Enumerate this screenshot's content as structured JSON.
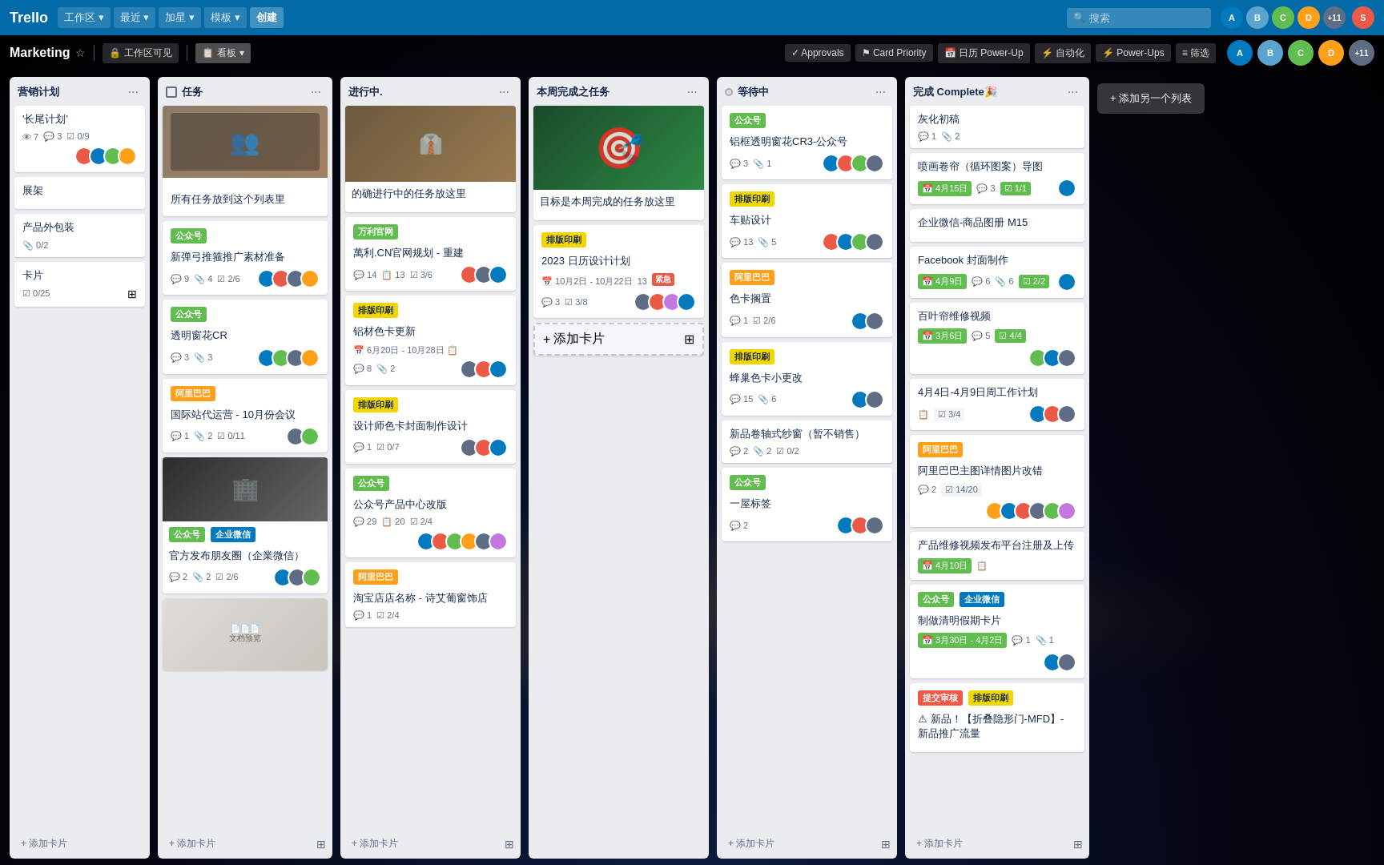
{
  "app": {
    "logo": "Trello",
    "nav": [
      {
        "label": "工作区",
        "hasArrow": true
      },
      {
        "label": "最近",
        "hasArrow": true
      },
      {
        "label": "加星",
        "hasArrow": true
      },
      {
        "label": "模板",
        "hasArrow": true
      },
      {
        "label": "创建",
        "isCreate": true
      }
    ],
    "search_placeholder": "搜索",
    "avatars": [
      "AB",
      "CD",
      "EF",
      "GH"
    ],
    "avatar_colors": [
      "#0079bf",
      "#5ba4cf",
      "#61bd4f",
      "#ff9f1a"
    ],
    "more_count": "+11"
  },
  "boardbar": {
    "title": "Marketing",
    "workspace_visibility": "工作区可见",
    "view_btn": "看板",
    "buttons": [
      {
        "label": "Approvals",
        "icon": "✓"
      },
      {
        "label": "Card Priority",
        "icon": "⚑"
      },
      {
        "label": "日历 Power-Up",
        "icon": "📅"
      },
      {
        "label": "自动化",
        "icon": "⚡"
      },
      {
        "label": "Power-Ups",
        "icon": "⚡"
      },
      {
        "label": "筛选",
        "icon": "≡"
      }
    ]
  },
  "columns": [
    {
      "id": "col1",
      "title": "营销计划",
      "hasCheckbox": false,
      "hasDot": false,
      "cards": [
        {
          "id": "c1",
          "title": "'长尾计划'",
          "tags": [],
          "meta": {
            "views": "7",
            "comments": "3",
            "attachments": "0/9"
          },
          "avatars": [
            {
              "color": "#eb5a46",
              "label": "A"
            },
            {
              "color": "#0079bf",
              "label": "B"
            },
            {
              "color": "#61bd4f",
              "label": "C"
            },
            {
              "color": "#ff9f1a",
              "label": "D"
            }
          ]
        },
        {
          "id": "c2",
          "title": "展架",
          "tags": [],
          "meta": {}
        },
        {
          "id": "c3",
          "title": "产品外包装",
          "tags": [],
          "meta": {
            "attachments": "0/2"
          },
          "avatars": []
        },
        {
          "id": "c4",
          "title": "卡片",
          "tags": [],
          "meta": {
            "check": "0/25"
          },
          "isArchive": true
        }
      ]
    },
    {
      "id": "col2",
      "title": "任务",
      "hasCheckbox": true,
      "cards": [
        {
          "id": "c5",
          "cover": "cover-people",
          "coverText": "",
          "title": "所有任务放到这个列表里",
          "tags": [],
          "meta": {}
        },
        {
          "id": "c6",
          "tags": [
            {
              "text": "公众号",
              "color": "tag-green"
            }
          ],
          "title": "新弹弓推箍推广素材准备",
          "meta": {
            "views": "",
            "comments": "9",
            "attachments": "4",
            "check": "2/6"
          },
          "avatars": [
            {
              "color": "#0079bf",
              "label": ""
            },
            {
              "color": "#eb5a46",
              "label": ""
            },
            {
              "color": "#5e6c84",
              "label": ""
            },
            {
              "color": "#ff9f1a",
              "label": ""
            }
          ]
        },
        {
          "id": "c7",
          "tags": [
            {
              "text": "公众号",
              "color": "tag-green"
            }
          ],
          "title": "透明窗花CR",
          "meta": {
            "comments": "3",
            "attachments": "3"
          },
          "avatars": [
            {
              "color": "#0079bf",
              "label": ""
            },
            {
              "color": "#61bd4f",
              "label": ""
            },
            {
              "color": "#5e6c84",
              "label": ""
            },
            {
              "color": "#ff9f1a",
              "label": ""
            }
          ]
        },
        {
          "id": "c8",
          "tags": [
            {
              "text": "阿里巴巴",
              "color": "tag-orange"
            }
          ],
          "title": "国际站代运营 - 10月份会议",
          "meta": {
            "comments": "1",
            "attachments": "2",
            "check": "0/11"
          },
          "avatars": [
            {
              "color": "#5e6c84",
              "label": ""
            },
            {
              "color": "#61bd4f",
              "label": ""
            }
          ]
        },
        {
          "id": "c9",
          "cover": "cover-room",
          "tags": [
            {
              "text": "公众号",
              "color": "tag-green"
            },
            {
              "text": "企业微信",
              "color": "tag-blue"
            }
          ],
          "title": "官方发布朋友圈（企業微信）",
          "meta": {
            "comments": "2",
            "attachments": "2",
            "check": "2/6"
          },
          "avatars": [
            {
              "color": "#0079bf",
              "label": ""
            },
            {
              "color": "#5e6c84",
              "label": ""
            },
            {
              "color": "#61bd4f",
              "label": ""
            }
          ]
        },
        {
          "id": "c10",
          "cover": "cover-docs",
          "tags": [],
          "title": "",
          "meta": {}
        }
      ]
    },
    {
      "id": "col3",
      "title": "进行中.",
      "cards": [
        {
          "id": "c11",
          "cover": "cover-people2",
          "editIcon": true,
          "tags": [],
          "title": "的确进行中的任务放这里",
          "meta": {}
        },
        {
          "id": "c12",
          "tags": [
            {
              "text": "万利官网",
              "color": "tag-green"
            }
          ],
          "title": "萬利.CN官网规划 - 重建",
          "meta": {
            "comments": "14",
            "comments2": "13",
            "check": "3/6"
          },
          "avatars": [
            {
              "color": "#eb5a46",
              "label": ""
            },
            {
              "color": "#5e6c84",
              "label": ""
            },
            {
              "color": "#0079bf",
              "label": ""
            }
          ]
        },
        {
          "id": "c13",
          "tags": [
            {
              "text": "排版印刷",
              "color": "tag-yellow"
            }
          ],
          "title": "铝材色卡更新",
          "date": "6月20日 - 10月28日",
          "meta": {
            "comments": "8",
            "attachments": "2"
          },
          "avatars": [
            {
              "color": "#5e6c84",
              "label": ""
            },
            {
              "color": "#eb5a46",
              "label": ""
            },
            {
              "color": "#0079bf",
              "label": ""
            }
          ]
        },
        {
          "id": "c14",
          "tags": [
            {
              "text": "排版印刷",
              "color": "tag-yellow"
            }
          ],
          "title": "设计师色卡封面制作设计",
          "meta": {
            "comments": "1",
            "check": "0/7"
          },
          "avatars": [
            {
              "color": "#5e6c84",
              "label": ""
            },
            {
              "color": "#eb5a46",
              "label": ""
            },
            {
              "color": "#0079bf",
              "label": ""
            }
          ]
        },
        {
          "id": "c15",
          "tags": [
            {
              "text": "公众号",
              "color": "tag-green"
            }
          ],
          "title": "公众号产品中心改版",
          "meta": {
            "comments": "29",
            "comments2": "20",
            "check": "2/4"
          },
          "avatars": [
            {
              "color": "#0079bf",
              "label": ""
            },
            {
              "color": "#eb5a46",
              "label": ""
            },
            {
              "color": "#61bd4f",
              "label": ""
            },
            {
              "color": "#ff9f1a",
              "label": ""
            },
            {
              "color": "#5e6c84",
              "label": ""
            },
            {
              "color": "#c377e0",
              "label": ""
            }
          ]
        },
        {
          "id": "c16",
          "tags": [
            {
              "text": "阿里巴巴",
              "color": "tag-orange"
            }
          ],
          "title": "淘宝店店名称 - 诗艾葡窗饰店",
          "meta": {
            "comments": "1",
            "check": "2/4"
          },
          "avatars": []
        }
      ]
    },
    {
      "id": "col4",
      "title": "本周完成之任务",
      "cards": [
        {
          "id": "c17",
          "cover": "cover-target",
          "title": "目标是本周完成的任务放这里",
          "meta": {}
        },
        {
          "id": "c18",
          "tags": [
            {
              "text": "排版印刷",
              "color": "tag-yellow"
            }
          ],
          "title": "2023 日历设计计划",
          "date": "10月2日 - 10月22日",
          "dateCount": "13",
          "meta": {
            "comments": "3",
            "check": "3/8"
          },
          "urgentBadge": true,
          "avatars": [
            {
              "color": "#5e6c84",
              "label": ""
            },
            {
              "color": "#eb5a46",
              "label": ""
            },
            {
              "color": "#c377e0",
              "label": ""
            },
            {
              "color": "#0079bf",
              "label": ""
            }
          ]
        }
      ]
    },
    {
      "id": "col5",
      "title": "等待中",
      "hasDot": true,
      "dotColor": "#ddd",
      "cards": [
        {
          "id": "c19",
          "tags": [
            {
              "text": "公众号",
              "color": "tag-green"
            }
          ],
          "title": "铝框透明窗花CR3-公众号",
          "meta": {
            "comments": "3",
            "attachments": "1"
          },
          "avatars": [
            {
              "color": "#0079bf",
              "label": ""
            },
            {
              "color": "#eb5a46",
              "label": ""
            },
            {
              "color": "#61bd4f",
              "label": ""
            },
            {
              "color": "#5e6c84",
              "label": ""
            }
          ]
        },
        {
          "id": "c20",
          "tags": [
            {
              "text": "排版印刷",
              "color": "tag-yellow"
            }
          ],
          "title": "车贴设计",
          "meta": {
            "comments": "13",
            "attachments": "5"
          },
          "avatars": [
            {
              "color": "#eb5a46",
              "label": ""
            },
            {
              "color": "#0079bf",
              "label": ""
            },
            {
              "color": "#61bd4f",
              "label": ""
            },
            {
              "color": "#5e6c84",
              "label": ""
            }
          ]
        },
        {
          "id": "c21",
          "tags": [
            {
              "text": "阿里巴巴",
              "color": "tag-orange"
            }
          ],
          "title": "色卡搁置",
          "meta": {
            "comments": "1",
            "check": "2/6"
          },
          "avatars": [
            {
              "color": "#0079bf",
              "label": ""
            },
            {
              "color": "#5e6c84",
              "label": ""
            }
          ]
        },
        {
          "id": "c22",
          "tags": [
            {
              "text": "排版印刷",
              "color": "tag-yellow"
            }
          ],
          "title": "蜂巢色卡小更改",
          "meta": {
            "comments": "15",
            "attachments": "6"
          },
          "avatars": [
            {
              "color": "#0079bf",
              "label": ""
            },
            {
              "color": "#5e6c84",
              "label": ""
            }
          ]
        },
        {
          "id": "c23",
          "title": "新品卷轴式纱窗（暂不销售）",
          "meta": {
            "comments": "2",
            "attachments": "2",
            "check": "0/2"
          },
          "avatars": []
        },
        {
          "id": "c24",
          "tags": [
            {
              "text": "公众号",
              "color": "tag-green"
            }
          ],
          "title": "一屋标签",
          "meta": {
            "comments": "2"
          },
          "avatars": [
            {
              "color": "#0079bf",
              "label": ""
            },
            {
              "color": "#eb5a46",
              "label": ""
            },
            {
              "color": "#5e6c84",
              "label": ""
            }
          ]
        }
      ]
    },
    {
      "id": "col6",
      "title": "完成 Complete🎉",
      "cards": [
        {
          "id": "c25",
          "title": "灰化初稿",
          "meta": {
            "comments": "1",
            "attachments": "2"
          },
          "avatars": []
        },
        {
          "id": "c26",
          "title": "喷画卷帘（循环图案）导图",
          "date": "4月15日",
          "dateDone": true,
          "meta": {
            "comments": "3",
            "check": "1/1"
          },
          "avatars": [
            {
              "color": "#0079bf",
              "label": ""
            }
          ]
        },
        {
          "id": "c27",
          "title": "企业微信-商品图册 M15",
          "meta": {}
        },
        {
          "id": "c28",
          "title": "Facebook 封面制作",
          "date": "4月9日",
          "dateDone": true,
          "meta": {
            "comments": "6",
            "attachments": "6",
            "check": "2/2"
          },
          "checkDone": true,
          "avatars": [
            {
              "color": "#0079bf",
              "label": ""
            }
          ]
        },
        {
          "id": "c29",
          "title": "百叶帘维修视频",
          "date": "3月6日",
          "dateDone": true,
          "meta": {
            "comments": "5",
            "check": "4/4"
          },
          "checkDone": true,
          "avatars": [
            {
              "color": "#61bd4f",
              "label": ""
            },
            {
              "color": "#0079bf",
              "label": ""
            },
            {
              "color": "#5e6c84",
              "label": ""
            }
          ]
        },
        {
          "id": "c30",
          "title": "4月4日-4月9日周工作计划",
          "meta": {
            "check": "3/4"
          },
          "avatars": [
            {
              "color": "#0079bf",
              "label": ""
            },
            {
              "color": "#eb5a46",
              "label": ""
            },
            {
              "color": "#5e6c84",
              "label": ""
            }
          ]
        },
        {
          "id": "c31",
          "tags": [
            {
              "text": "阿里巴巴",
              "color": "tag-orange"
            }
          ],
          "title": "阿里巴巴主图详情图片改错",
          "meta": {
            "comments": "2",
            "check": "14/20"
          },
          "avatars": [
            {
              "color": "#ff9f1a",
              "label": ""
            },
            {
              "color": "#0079bf",
              "label": ""
            },
            {
              "color": "#eb5a46",
              "label": ""
            },
            {
              "color": "#5e6c84",
              "label": ""
            },
            {
              "color": "#61bd4f",
              "label": ""
            },
            {
              "color": "#c377e0",
              "label": ""
            }
          ]
        },
        {
          "id": "c32",
          "title": "产品维修视频发布平台注册及上传",
          "date": "4月10日",
          "dateDone": true,
          "meta": {},
          "avatars": []
        },
        {
          "id": "c33",
          "tags": [
            {
              "text": "公众号",
              "color": "tag-green"
            },
            {
              "text": "企业微信",
              "color": "tag-blue"
            }
          ],
          "title": "制做清明假期卡片",
          "date": "3月30日 - 4月2日",
          "dateDone": true,
          "meta": {
            "comments": "1",
            "attachments": "1"
          },
          "avatars": [
            {
              "color": "#0079bf",
              "label": ""
            },
            {
              "color": "#5e6c84",
              "label": ""
            }
          ]
        },
        {
          "id": "c34",
          "tags": [
            {
              "text": "提交审核",
              "color": "tag-red"
            },
            {
              "text": "排版印刷",
              "color": "tag-yellow"
            }
          ],
          "title": "⚠ 新品！【折叠隐形门-MFD】- 新品推广流量",
          "meta": {}
        }
      ]
    }
  ],
  "add_list_label": "+ 添加另一个列表",
  "add_card_label": "+ 添加卡片",
  "add_card_label2": "+ 添加卡片"
}
